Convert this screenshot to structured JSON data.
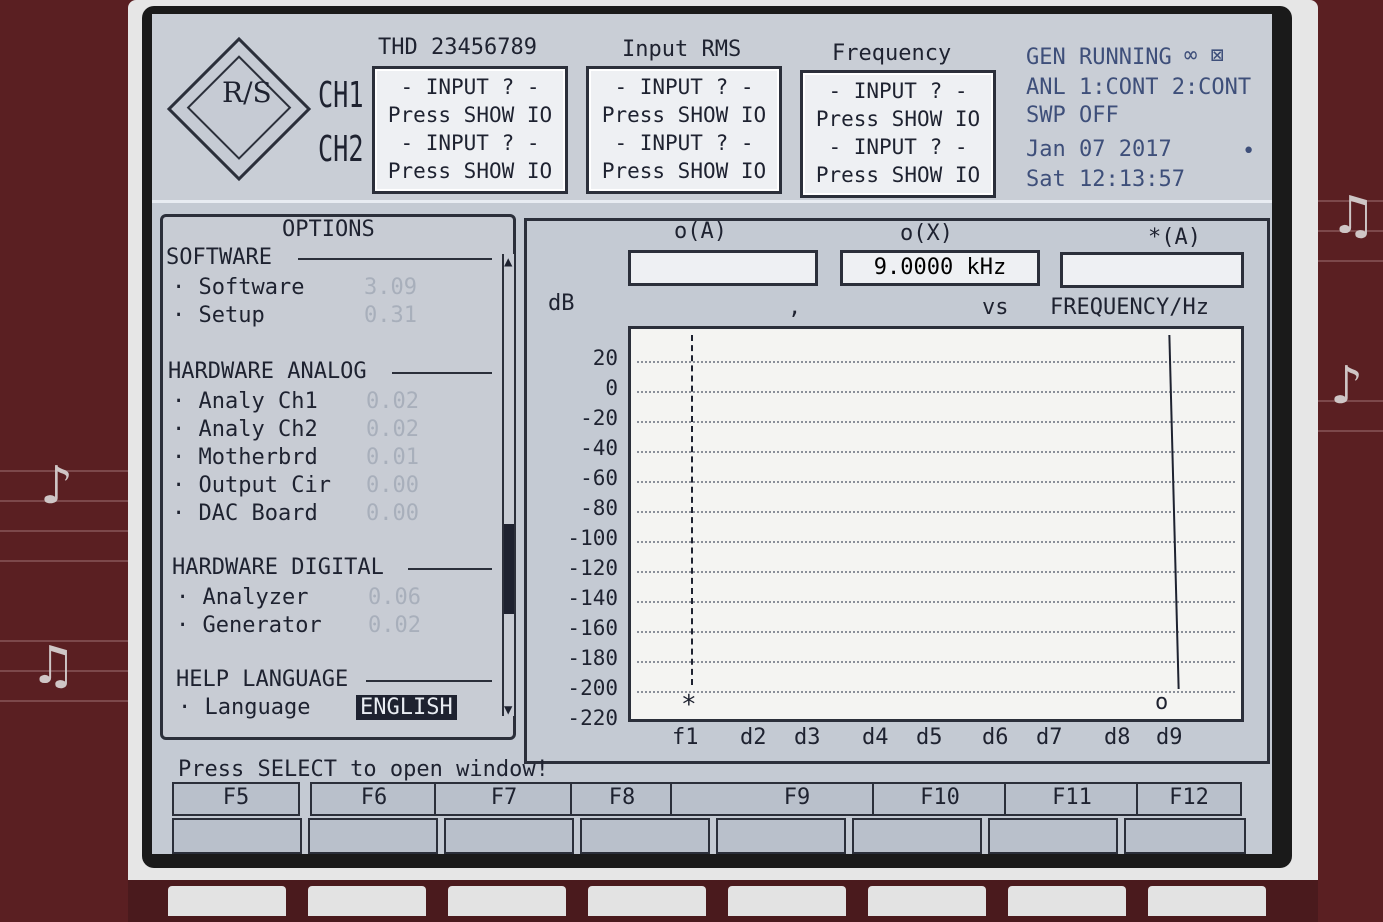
{
  "header": {
    "ch1_label": "CH1",
    "ch2_label": "CH2",
    "col_thd_title": "THD 23456789",
    "col_rms_title": "Input RMS",
    "col_freq_title": "Frequency",
    "box_line_a": "- INPUT ? -",
    "box_line_b": "Press SHOW IO",
    "logo_text": "R/S"
  },
  "status": {
    "gen": "GEN RUNNING",
    "anl": "ANL 1:CONT 2:CONT",
    "swp": "SWP OFF",
    "date": "Jan 07 2017",
    "time": "Sat 12:13:57"
  },
  "options": {
    "title": "OPTIONS",
    "software_heading": "SOFTWARE",
    "software_items": [
      {
        "label": "Software",
        "value": "3.09"
      },
      {
        "label": "Setup",
        "value": "0.31"
      }
    ],
    "hw_analog_heading": "HARDWARE ANALOG",
    "hw_analog_items": [
      {
        "label": "Analy Ch1",
        "value": "0.02"
      },
      {
        "label": "Analy Ch2",
        "value": "0.02"
      },
      {
        "label": "Motherbrd",
        "value": "0.01"
      },
      {
        "label": "Output Cir",
        "value": "0.00"
      },
      {
        "label": "DAC Board",
        "value": "0.00"
      }
    ],
    "hw_digital_heading": "HARDWARE DIGITAL",
    "hw_digital_items": [
      {
        "label": "Analyzer",
        "value": "0.06"
      },
      {
        "label": "Generator",
        "value": "0.02"
      }
    ],
    "help_heading": "HELP LANGUAGE",
    "language_label": "Language",
    "language_value": "ENGLISH"
  },
  "graph": {
    "read_a_label": "o(A)",
    "read_x_label": "o(X)",
    "read_star_label": "*(A)",
    "read_a_value": "",
    "read_x_value": "9.0000 kHz",
    "read_star_value": "",
    "y_unit": "dB",
    "comma": ",",
    "vs": "vs",
    "x_title": "FREQUENCY/Hz",
    "y_ticks": [
      "20",
      "0",
      "-20",
      "-40",
      "-60",
      "-80",
      "-100",
      "-120",
      "-140",
      "-160",
      "-180",
      "-200",
      "-220"
    ],
    "x_ticks": [
      "f1",
      "d2",
      "d3",
      "d4",
      "d5",
      "d6",
      "d7",
      "d8",
      "d9"
    ],
    "marker_star": "*",
    "marker_circle": "o"
  },
  "prompt": "Press SELECT to open window!",
  "fkeys": [
    "F5",
    "F6",
    "F7",
    "F8",
    "F9",
    "F10",
    "F11",
    "F12"
  ],
  "chart_data": {
    "type": "line",
    "xlabel": "FREQUENCY/Hz",
    "ylabel": "dB",
    "categories": [
      "f1",
      "d2",
      "d3",
      "d4",
      "d5",
      "d6",
      "d7",
      "d8",
      "d9"
    ],
    "ylim": [
      -220,
      20
    ],
    "grid": true
  }
}
